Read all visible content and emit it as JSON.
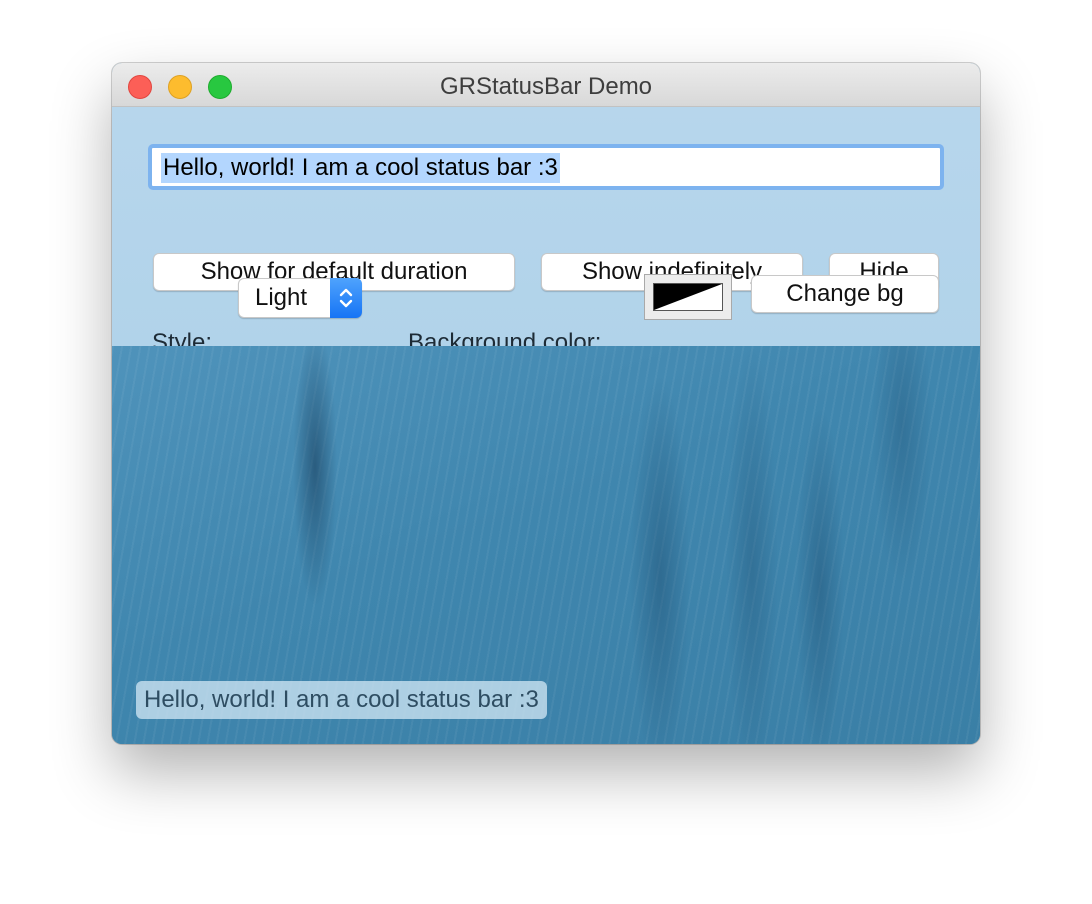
{
  "window": {
    "title": "GRStatusBar Demo"
  },
  "controls": {
    "message_field": {
      "value": "Hello, world! I am a cool status bar :3"
    },
    "buttons": {
      "show_default": "Show for default duration",
      "show_indefinitely": "Show indefinitely",
      "hide": "Hide",
      "change_bg": "Change bg"
    },
    "style_label": "Style:",
    "style_selected": "Light",
    "background_color_label": "Background color:"
  },
  "status_bar": {
    "text": "Hello, world! I am a cool status bar :3"
  },
  "colors": {
    "controls_background": "#b7d6ec",
    "focus_ring": "#7db3ef",
    "selection": "#b3d6fe",
    "popup_arrows": "#1674f5",
    "content_background": "#3f86ae",
    "status_bar_text": "#2e4d62"
  },
  "icons": {
    "close": "close-window-icon",
    "minimize": "minimize-window-icon",
    "maximize": "zoom-window-icon",
    "popup": "chevron-up-down-icon",
    "swatch": "color-swatch-icon"
  }
}
